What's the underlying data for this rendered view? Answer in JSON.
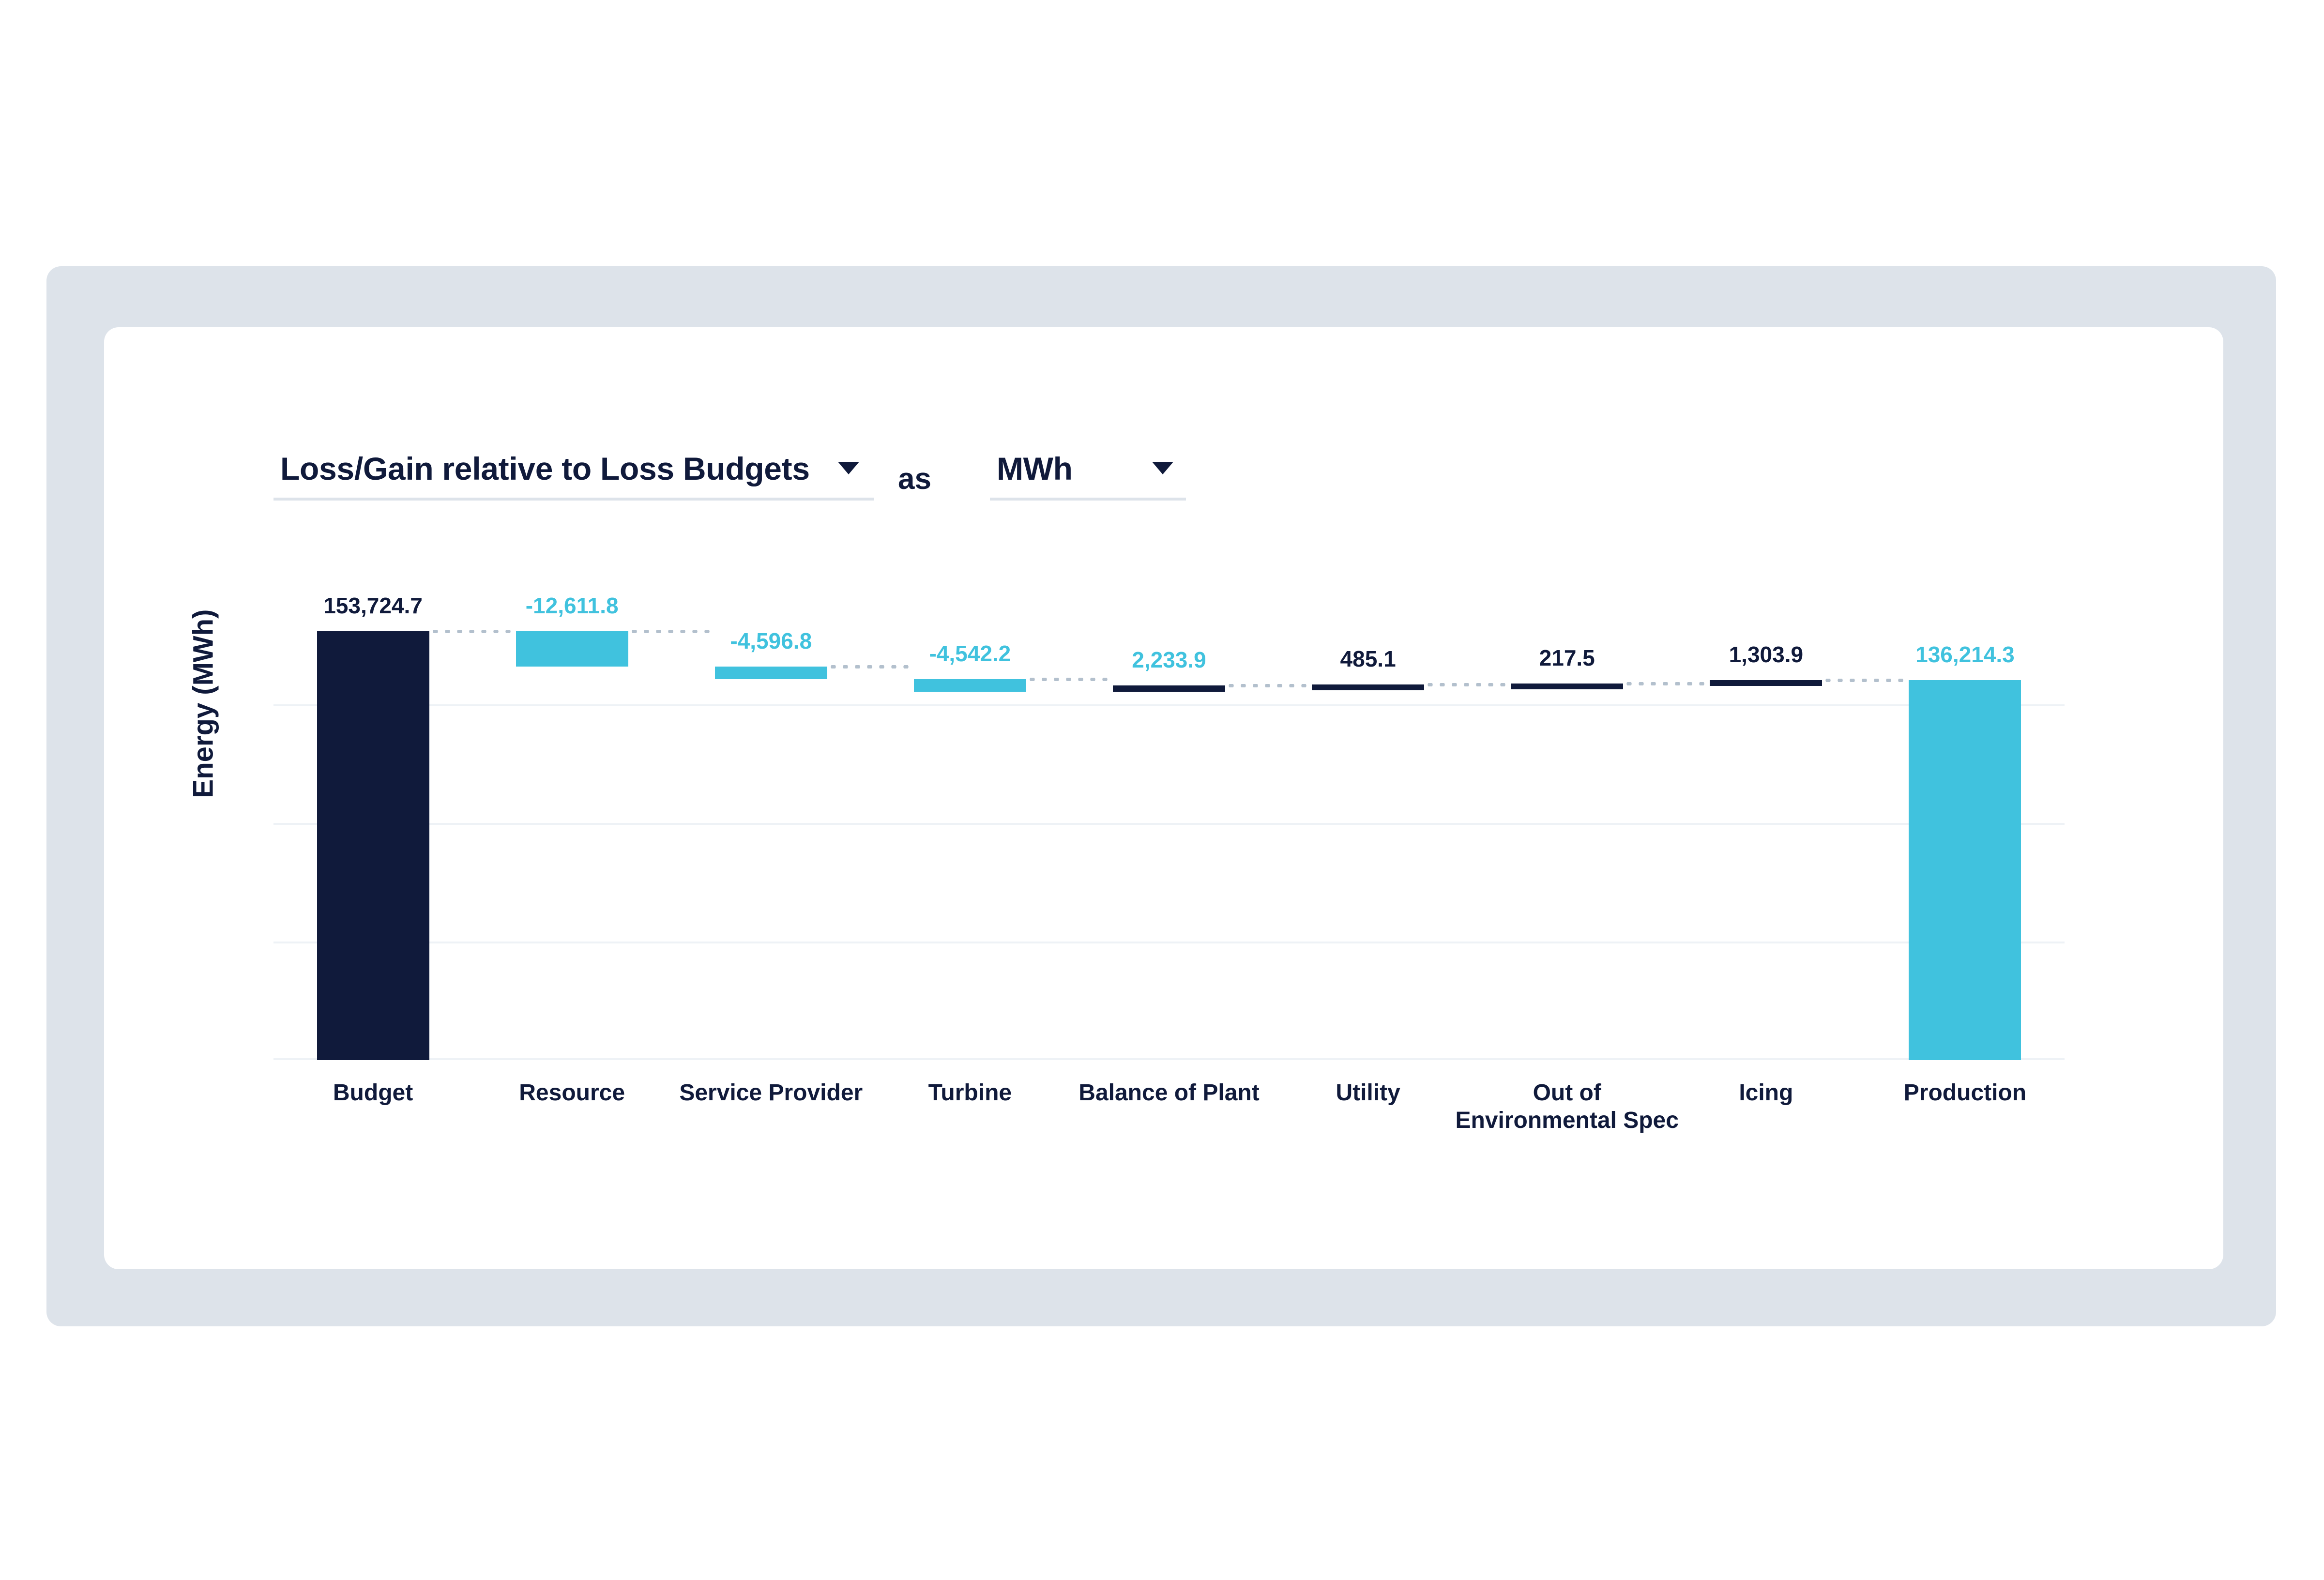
{
  "card": {
    "frame_color": "#dde3ea",
    "surface_color": "#ffffff"
  },
  "controls": {
    "metric_dropdown": {
      "name": "metric-select",
      "value": "Loss/Gain relative to Loss Budgets",
      "caret_icon": "chevron-down-icon"
    },
    "conjunction_label": "as",
    "unit_dropdown": {
      "name": "unit-select",
      "value": "MWh",
      "caret_icon": "chevron-down-icon"
    }
  },
  "chart_data": {
    "type": "bar",
    "subtype": "waterfall",
    "title": "",
    "subtitle": "",
    "xlabel": "",
    "ylabel": "Energy (MWh)",
    "ylim": [
      0,
      170000
    ],
    "grid": true,
    "gridlines": [
      42500,
      85000,
      127500
    ],
    "legend": null,
    "y_tick_labels": [],
    "colors": {
      "loss": "#40c2de",
      "gain": "#101a3b",
      "start_total": "#101a3b",
      "end_total": "#40c2de",
      "connector": "#b3c0cd",
      "gridline": "#eef2f6"
    },
    "categories": [
      "Budget",
      "Resource",
      "Service Provider",
      "Turbine",
      "Balance of Plant",
      "Utility",
      "Out of Environmental Spec",
      "Icing",
      "Production"
    ],
    "category_label_lines": [
      [
        "Budget"
      ],
      [
        "Resource"
      ],
      [
        "Service Provider"
      ],
      [
        "Turbine"
      ],
      [
        "Balance of Plant"
      ],
      [
        "Utility"
      ],
      [
        "Out of",
        "Environmental Spec"
      ],
      [
        "Icing"
      ],
      [
        "Production"
      ]
    ],
    "values": [
      153724.7,
      -12611.8,
      -4596.8,
      -4542.2,
      2233.9,
      485.1,
      217.5,
      1303.9,
      136214.3
    ],
    "value_labels": [
      "153,724.7",
      "-12,611.8",
      "-4,596.8",
      "-4,542.2",
      "2,233.9",
      "485.1",
      "217.5",
      "1,303.9",
      "136,214.3"
    ],
    "bar_kinds": [
      "total",
      "loss",
      "loss",
      "loss",
      "gain",
      "gain",
      "gain",
      "gain",
      "total"
    ],
    "label_colors": [
      "#101a3b",
      "#40c2de",
      "#40c2de",
      "#40c2de",
      "#40c2de",
      "#101a3b",
      "#101a3b",
      "#101a3b",
      "#40c2de"
    ],
    "cumulative_start": [
      0,
      141112.9,
      136516.1,
      131973.9,
      131973.9,
      134207.8,
      134692.9,
      134910.4,
      0
    ],
    "cumulative_end": [
      153724.7,
      153724.7,
      141112.9,
      136516.1,
      134207.8,
      134692.9,
      134910.4,
      136214.3,
      136214.3
    ]
  }
}
